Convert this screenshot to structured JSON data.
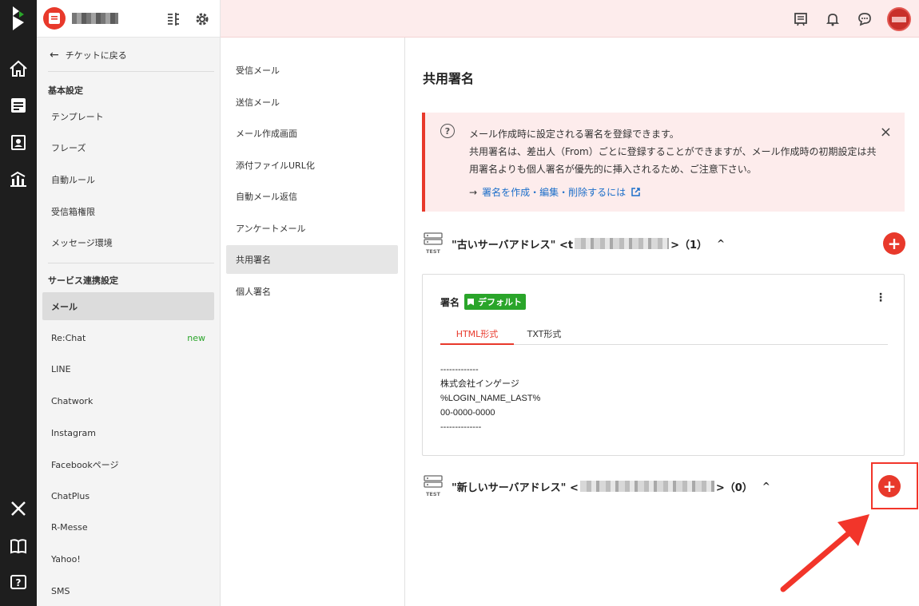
{
  "colors": {
    "accent": "#e8392b",
    "success": "#2aa52a",
    "link": "#1c6ec9"
  },
  "rail": {
    "icons": [
      "logo-icon",
      "home-icon",
      "ticket-icon",
      "contacts-icon",
      "analytics-icon",
      "tools-icon",
      "book-icon",
      "help-icon"
    ]
  },
  "header": {
    "icons": [
      "list-icon",
      "gear-icon",
      "news-icon",
      "bell-icon",
      "chat-icon"
    ]
  },
  "sidebar": {
    "back_label": "チケットに戻る",
    "section1_title": "基本設定",
    "section1_items": [
      "テンプレート",
      "フレーズ",
      "自動ルール",
      "受信箱権限",
      "メッセージ環境"
    ],
    "section2_title": "サービス連携設定",
    "section2_items": [
      "メール",
      "Re:Chat",
      "LINE",
      "Chatwork",
      "Instagram",
      "Facebookページ",
      "ChatPlus",
      "R-Messe",
      "Yahoo!",
      "SMS"
    ],
    "new_badge": "new"
  },
  "subnav": {
    "items": [
      "受信メール",
      "送信メール",
      "メール作成画面",
      "添付ファイルURL化",
      "自動メール返信",
      "アンケートメール",
      "共用署名",
      "個人署名"
    ]
  },
  "main": {
    "title": "共用署名",
    "alert": {
      "line1": "メール作成時に設定される署名を登録できます。",
      "line2": "共用署名は、差出人（From）ごとに登録することができますが、メール作成時の初期設定は共用署名よりも個人署名が優先的に挿入されるため、ご注意下さい。",
      "link": "署名を作成・編集・削除するには",
      "link_arrow": "→",
      "close": "×"
    },
    "group1": {
      "title_prefix": "\"古いサーバアドレス\" <t",
      "title_suffix": ">（1）",
      "chevron": "^"
    },
    "card": {
      "title": "署名",
      "badge": "デフォルト",
      "tab_html": "HTML形式",
      "tab_txt": "TXT形式",
      "signature": [
        "-------------",
        "株式会社インゲージ",
        "%LOGIN_NAME_LAST%",
        "00-0000-0000",
        "--------------"
      ]
    },
    "group2": {
      "title_prefix": "\"新しいサーバアドレス\" <",
      "title_suffix": ">（0）",
      "chevron": "^"
    },
    "add": "+"
  }
}
